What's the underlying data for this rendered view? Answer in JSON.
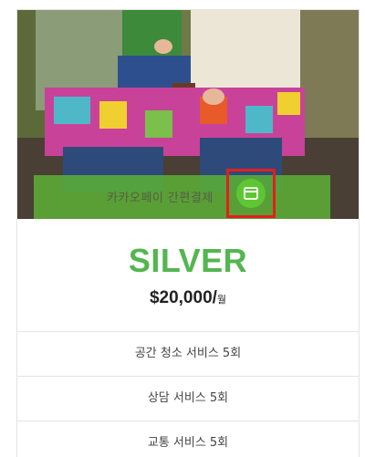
{
  "payment": {
    "label": "카카오페이 간편결제",
    "icon": "credit-card-icon"
  },
  "plan": {
    "name": "SILVER",
    "price": "$20,000/",
    "period": "월"
  },
  "features": [
    "공간 청소 서비스 5회",
    "상담 서비스 5회",
    "교통 서비스 5회"
  ],
  "colors": {
    "accent": "#54b650",
    "pay_bar": "#5cb036",
    "highlight": "#e41e1e"
  }
}
